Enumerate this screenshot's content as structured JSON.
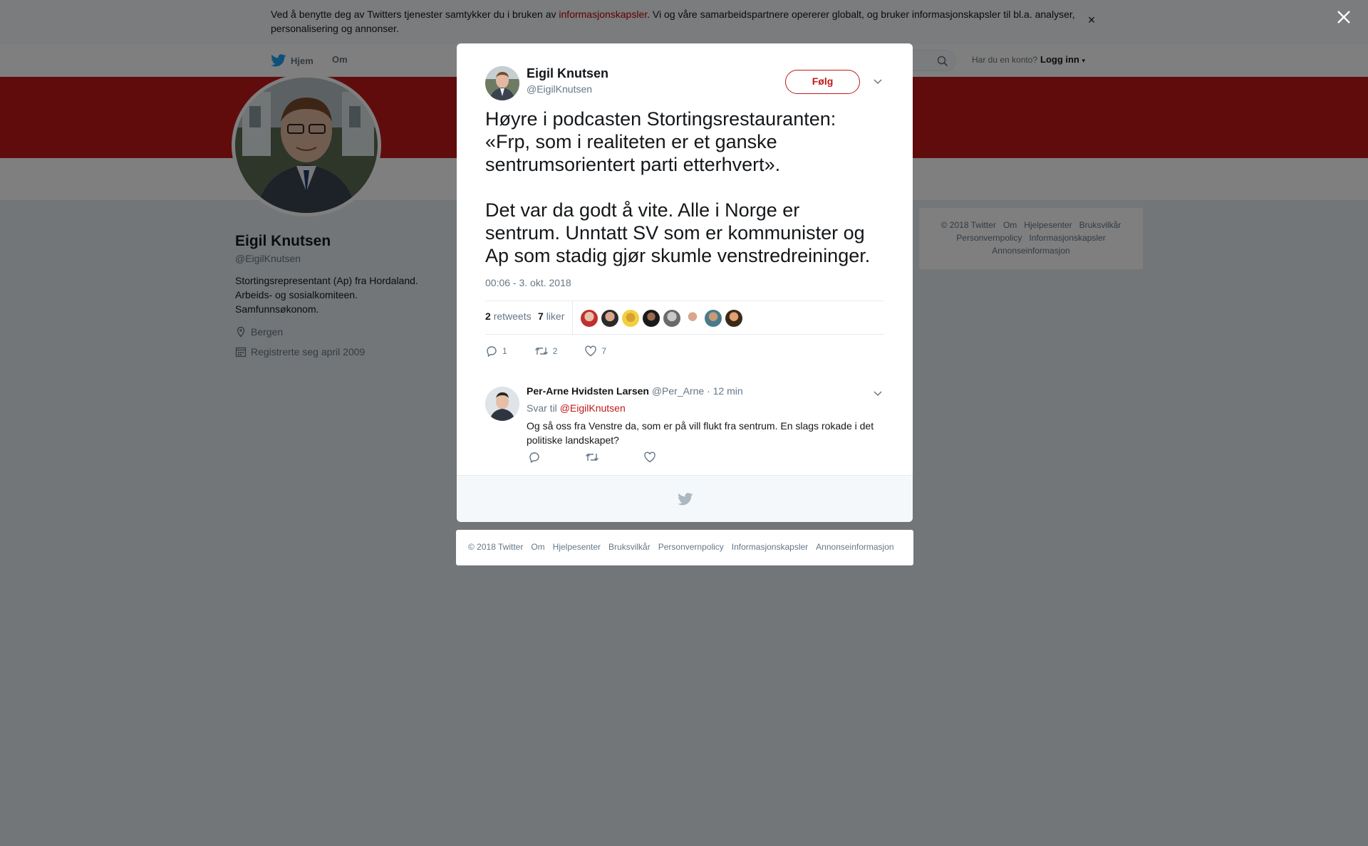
{
  "cookie_bar": {
    "text_before": "Ved å benytte deg av Twitters tjenester samtykker du i bruken av ",
    "link": "informasjonskapsler",
    "text_after": ". Vi og våre samarbeidspartnere opererer globalt, og bruker informasjonskapsler til bl.a. analyser, personalisering og annonser.",
    "close": "×"
  },
  "nav": {
    "home": "Hjem",
    "about": "Om",
    "account_prompt": "Har du en konto?",
    "login": "Logg inn"
  },
  "profile": {
    "name": "Eigil Knutsen",
    "handle": "@EigilKnutsen",
    "bio": [
      "Stortingsrepresentant (Ap) fra Hordaland.",
      "Arbeids- og sosialkomiteen.",
      "Samfunnsøkonom."
    ],
    "location": "Bergen",
    "joined": "Registrerte seg april 2009"
  },
  "sidebar_footer": {
    "links": [
      "© 2018 Twitter",
      "Om",
      "Hjelpesenter",
      "Bruksvilkår",
      "Personvernpolicy",
      "Informasjonskapsler",
      "Annonseinformasjon"
    ]
  },
  "tweet": {
    "author_name": "Eigil Knutsen",
    "author_handle": "@EigilKnutsen",
    "follow_label": "Følg",
    "text_lines": [
      "Høyre i podcasten Stortingsrestauranten:",
      "«Frp, som i realiteten er et ganske",
      "sentrumsorientert parti etterhvert».",
      "",
      "Det var da godt å vite. Alle i Norge er",
      "sentrum. Unntatt SV som er kommunister og",
      "Ap som stadig gjør skumle venstredreininger."
    ],
    "timestamp": "00:06 - 3. okt. 2018",
    "retweets_count": "2",
    "retweets_label": "retweets",
    "likes_count": "7",
    "likes_label": "liker",
    "reply_count": "1",
    "retweet_count": "2",
    "like_count": "7"
  },
  "reply": {
    "name": "Per-Arne Hvidsten Larsen",
    "handle": "@Per_Arne",
    "time": "· 12 min",
    "reply_to_label": "Svar til",
    "reply_to_handle": "@EigilKnutsen",
    "text_lines": [
      "Og så oss fra Venstre da, som er på vill flukt fra sentrum. En slags rokade i det",
      "politiske landskapet?"
    ]
  },
  "modal_footer": {
    "links": [
      "© 2018 Twitter",
      "Om",
      "Hjelpesenter",
      "Bruksvilkår",
      "Personvernpolicy",
      "Informasjonskapsler",
      "Annonseinformasjon"
    ]
  },
  "colors": {
    "brand_red": "#c0181b",
    "twitter_blue": "#1da1f2",
    "muted_text": "#657786",
    "overlay": "rgba(0,0,0,0.5)"
  },
  "icons": {
    "bird": "twitter-bird-icon",
    "search": "search-icon",
    "location": "location-pin-icon",
    "calendar": "calendar-icon",
    "close": "close-icon",
    "caret": "chevron-down-icon",
    "reply": "reply-icon",
    "retweet": "retweet-icon",
    "like": "heart-icon"
  }
}
